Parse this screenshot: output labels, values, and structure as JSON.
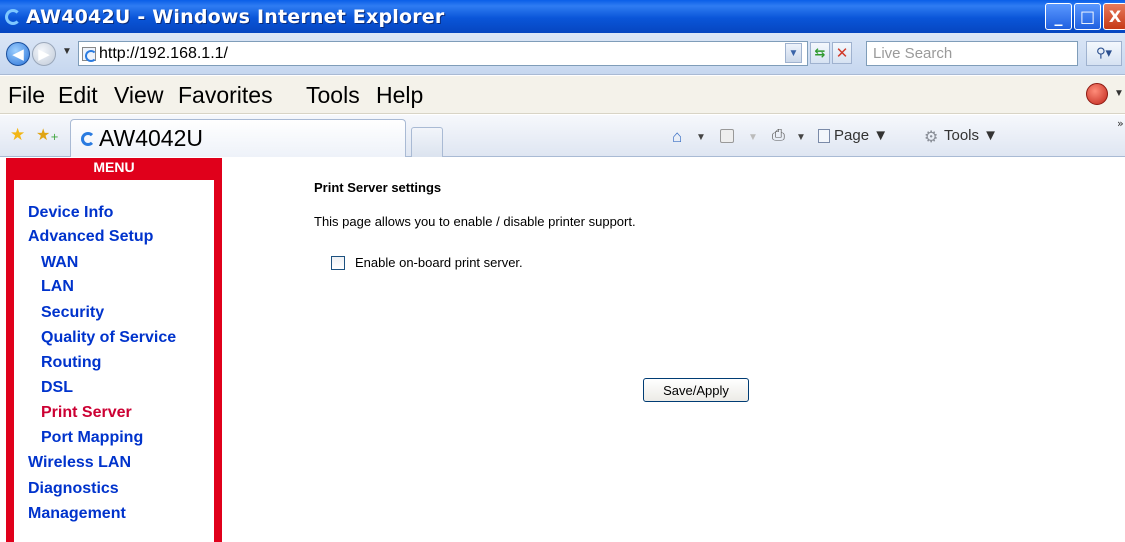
{
  "window": {
    "title": "AW4042U - Windows Internet Explorer",
    "minimize": "_",
    "maximize": "□",
    "close": "X"
  },
  "address_bar": {
    "url": "http://192.168.1.1/",
    "search_placeholder": "Live Search"
  },
  "menubar": {
    "items": [
      "File",
      "Edit",
      "View",
      "Favorites",
      "Tools",
      "Help"
    ]
  },
  "tabs": {
    "active_label": "AW4042U"
  },
  "command_bar": {
    "page_label": "Page ▼",
    "tools_label": "Tools ▼"
  },
  "sidebar": {
    "header": "MENU",
    "items": [
      {
        "label": "Device Info",
        "indent": 0,
        "active": false
      },
      {
        "label": "Advanced Setup",
        "indent": 0,
        "active": false
      },
      {
        "label": "WAN",
        "indent": 1,
        "active": false
      },
      {
        "label": "LAN",
        "indent": 1,
        "active": false
      },
      {
        "label": "Security",
        "indent": 1,
        "active": false
      },
      {
        "label": "Quality of Service",
        "indent": 1,
        "active": false
      },
      {
        "label": "Routing",
        "indent": 1,
        "active": false
      },
      {
        "label": "DSL",
        "indent": 1,
        "active": false
      },
      {
        "label": "Print Server",
        "indent": 1,
        "active": true
      },
      {
        "label": "Port Mapping",
        "indent": 1,
        "active": false
      },
      {
        "label": "Wireless LAN",
        "indent": 0,
        "active": false
      },
      {
        "label": "Diagnostics",
        "indent": 0,
        "active": false
      },
      {
        "label": "Management",
        "indent": 0,
        "active": false
      }
    ]
  },
  "content": {
    "title": "Print Server settings",
    "description": "This page allows you to enable / disable printer support.",
    "checkbox_label": "Enable on-board print server.",
    "checkbox_checked": false,
    "save_button": "Save/Apply"
  },
  "colors": {
    "sidebar_border": "#e0001b",
    "link_color": "#0033cc",
    "active_link_color": "#cc0033"
  }
}
